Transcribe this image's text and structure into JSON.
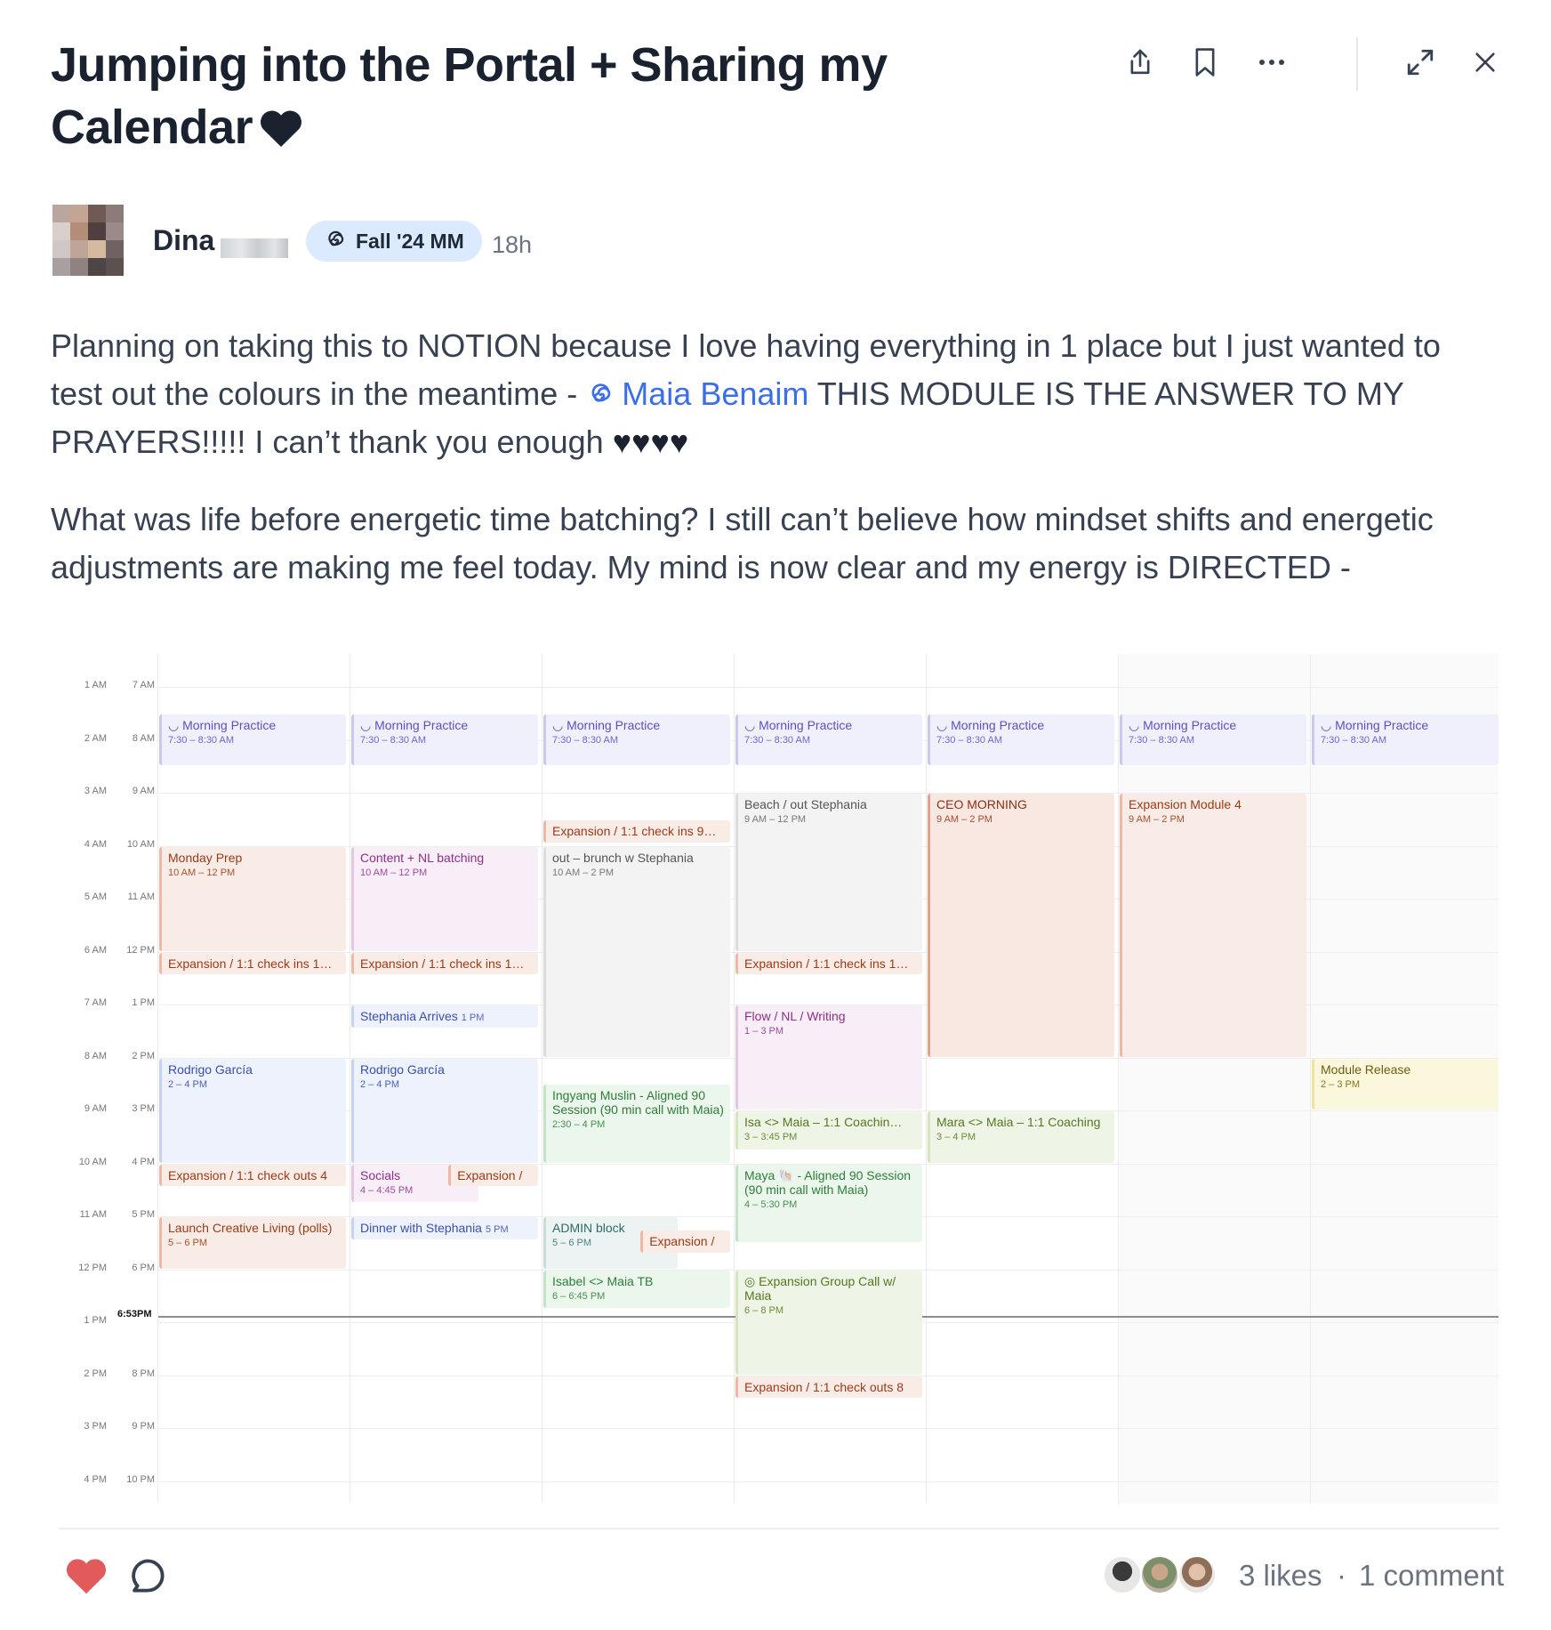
{
  "post": {
    "title": "Jumping into the Portal + Sharing my Calendar",
    "author_name": "Dina",
    "badge": "Fall '24 MM",
    "time_ago": "18h",
    "p1_a": "Planning on taking this to NOTION because I love having everything in 1 place but I just wanted to test out the colours in the meantime - ",
    "mention": "Maia Benaim",
    "p1_b": " THIS MODULE IS THE ANSWER TO MY PRAYERS!!!!! I can’t thank you enough ",
    "p1_hearts": "♥♥♥♥",
    "p2": "What was life before energetic time batching? I still can’t believe how mindset shifts and energetic adjustments are making me feel today. My mind is now clear and my energy is DIRECTED -"
  },
  "toolbar": {
    "share_icon": "share-icon",
    "bookmark_icon": "bookmark-icon",
    "more_icon": "more-icon",
    "expand_icon": "expand-icon",
    "close_icon": "close-icon"
  },
  "calendar": {
    "left_times": [
      "1 AM",
      "2 AM",
      "3 AM",
      "4 AM",
      "5 AM",
      "6 AM",
      "7 AM",
      "8 AM",
      "9 AM",
      "10 AM",
      "11 AM",
      "12 PM",
      "1 PM",
      "2 PM",
      "3 PM",
      "4 PM"
    ],
    "right_times": [
      "7 AM",
      "8 AM",
      "9 AM",
      "10 AM",
      "11 AM",
      "12 PM",
      "1 PM",
      "2 PM",
      "3 PM",
      "4 PM",
      "5 PM",
      "6 PM",
      "",
      "8 PM",
      "9 PM",
      "10 PM"
    ],
    "now_label": "6:53PM",
    "events": [
      {
        "day": 0,
        "start": 7.5,
        "end": 8.5,
        "title": "Morning Practice",
        "time": "7:30 – 8:30 AM",
        "color": "purple",
        "icon": true
      },
      {
        "day": 1,
        "start": 7.5,
        "end": 8.5,
        "title": "Morning Practice",
        "time": "7:30 – 8:30 AM",
        "color": "purple",
        "icon": true
      },
      {
        "day": 2,
        "start": 7.5,
        "end": 8.5,
        "title": "Morning Practice",
        "time": "7:30 – 8:30 AM",
        "color": "purple",
        "icon": true
      },
      {
        "day": 3,
        "start": 7.5,
        "end": 8.5,
        "title": "Morning Practice",
        "time": "7:30 – 8:30 AM",
        "color": "purple",
        "icon": true
      },
      {
        "day": 4,
        "start": 7.5,
        "end": 8.5,
        "title": "Morning Practice",
        "time": "7:30 – 8:30 AM",
        "color": "purple",
        "icon": true
      },
      {
        "day": 5,
        "start": 7.5,
        "end": 8.5,
        "title": "Morning Practice",
        "time": "7:30 – 8:30 AM",
        "color": "purple",
        "icon": true
      },
      {
        "day": 6,
        "start": 7.5,
        "end": 8.5,
        "title": "Morning Practice",
        "time": "7:30 – 8:30 AM",
        "color": "purple",
        "icon": true
      },
      {
        "day": 0,
        "start": 10,
        "end": 12,
        "title": "Monday Prep",
        "time": "10 AM – 12 PM",
        "color": "salmon"
      },
      {
        "day": 0,
        "start": 12,
        "end": 12.45,
        "title": "Expansion / 1:1 check ins 1…",
        "time": "",
        "color": "salmon"
      },
      {
        "day": 0,
        "start": 14,
        "end": 16,
        "title": "Rodrigo García",
        "time": "2 – 4 PM",
        "color": "blue"
      },
      {
        "day": 0,
        "start": 16,
        "end": 16.45,
        "title": "Expansion / 1:1 check outs 4",
        "time": "",
        "color": "salmon"
      },
      {
        "day": 0,
        "start": 17,
        "end": 18,
        "title": "Launch Creative Living (polls)",
        "time": "5 – 6 PM",
        "color": "salmon",
        "wrap": true
      },
      {
        "day": 1,
        "start": 10,
        "end": 12,
        "title": "Content + NL batching",
        "time": "10 AM – 12 PM",
        "color": "pink"
      },
      {
        "day": 1,
        "start": 12,
        "end": 12.45,
        "title": "Expansion / 1:1 check ins 1…",
        "time": "",
        "color": "salmon"
      },
      {
        "day": 1,
        "start": 13,
        "end": 13.45,
        "title": "Stephania Arrives",
        "time": "1 PM",
        "color": "blue",
        "inline": true
      },
      {
        "day": 1,
        "start": 14,
        "end": 16,
        "title": "Rodrigo García",
        "time": "2 – 4 PM",
        "color": "blue"
      },
      {
        "day": 1,
        "start": 16,
        "end": 16.75,
        "title": "Socials",
        "time": "4 – 4:45 PM",
        "color": "pink",
        "widthFrac": 0.68
      },
      {
        "day": 1,
        "start": 16,
        "end": 16.45,
        "title": "Expansion /",
        "time": "",
        "color": "salmon",
        "leftFrac": 0.52,
        "widthFrac": 0.48
      },
      {
        "day": 1,
        "start": 17,
        "end": 17.45,
        "title": "Dinner with Stephania",
        "time": "5 PM",
        "color": "blue",
        "inline": true
      },
      {
        "day": 2,
        "start": 9.5,
        "end": 9.95,
        "title": "Expansion / 1:1 check ins 9…",
        "time": "",
        "color": "salmon"
      },
      {
        "day": 2,
        "start": 10,
        "end": 14,
        "title": "out – brunch w Stephania",
        "time": "10 AM – 2 PM",
        "color": "gray"
      },
      {
        "day": 2,
        "start": 14.5,
        "end": 16,
        "title": "Ingyang Muslin - Aligned 90 Session (90 min call with Maia)",
        "time": "2:30 – 4 PM",
        "color": "green",
        "wrap": true
      },
      {
        "day": 2,
        "start": 17,
        "end": 18,
        "title": "ADMIN block",
        "time": "5 – 6 PM",
        "color": "teal",
        "widthFrac": 0.72
      },
      {
        "day": 2,
        "start": 17.25,
        "end": 17.7,
        "title": "Expansion /",
        "time": "",
        "color": "salmon",
        "leftFrac": 0.52,
        "widthFrac": 0.48
      },
      {
        "day": 2,
        "start": 18,
        "end": 18.75,
        "title": "Isabel <> Maia TB",
        "time": "6 – 6:45 PM",
        "color": "green"
      },
      {
        "day": 3,
        "start": 9,
        "end": 12,
        "title": "Beach / out Stephania",
        "time": "9 AM – 12 PM",
        "color": "gray"
      },
      {
        "day": 3,
        "start": 12,
        "end": 12.45,
        "title": "Expansion / 1:1 check ins 1…",
        "time": "",
        "color": "salmon"
      },
      {
        "day": 3,
        "start": 13,
        "end": 15,
        "title": "Flow / NL / Writing",
        "time": "1 – 3 PM",
        "color": "pink"
      },
      {
        "day": 3,
        "start": 15,
        "end": 15.75,
        "title": "Isa <> Maia – 1:1 Coachin…",
        "time": "3 – 3:45 PM",
        "color": "olive"
      },
      {
        "day": 3,
        "start": 16,
        "end": 17.5,
        "title": "Maya 🐚 - Aligned 90 Session (90 min call with Maia)",
        "time": "4 – 5:30 PM",
        "color": "green",
        "wrap": true
      },
      {
        "day": 3,
        "start": 18,
        "end": 20,
        "title": "Expansion Group Call w/ Maia",
        "time": "6 – 8 PM",
        "color": "olive",
        "wrap": true,
        "prefix": "◎ "
      },
      {
        "day": 3,
        "start": 20,
        "end": 20.45,
        "title": "Expansion / 1:1 check outs 8",
        "time": "",
        "color": "salmon"
      },
      {
        "day": 4,
        "start": 9,
        "end": 14,
        "title": "CEO MORNING",
        "time": "9 AM – 2 PM",
        "color": "deepsalmon"
      },
      {
        "day": 4,
        "start": 15,
        "end": 16,
        "title": "Mara <> Maia – 1:1 Coaching",
        "time": "3 – 4 PM",
        "color": "olive",
        "wrap": true
      },
      {
        "day": 5,
        "start": 9,
        "end": 14,
        "title": "Expansion Module 4",
        "time": "9 AM – 2 PM",
        "color": "salmon"
      },
      {
        "day": 6,
        "start": 14,
        "end": 15,
        "title": "Module Release",
        "time": "2 – 3 PM",
        "color": "yellow"
      }
    ]
  },
  "footer": {
    "likes": "3 likes",
    "separator": "·",
    "comments": "1 comment",
    "like_color": "#e25a5a"
  }
}
